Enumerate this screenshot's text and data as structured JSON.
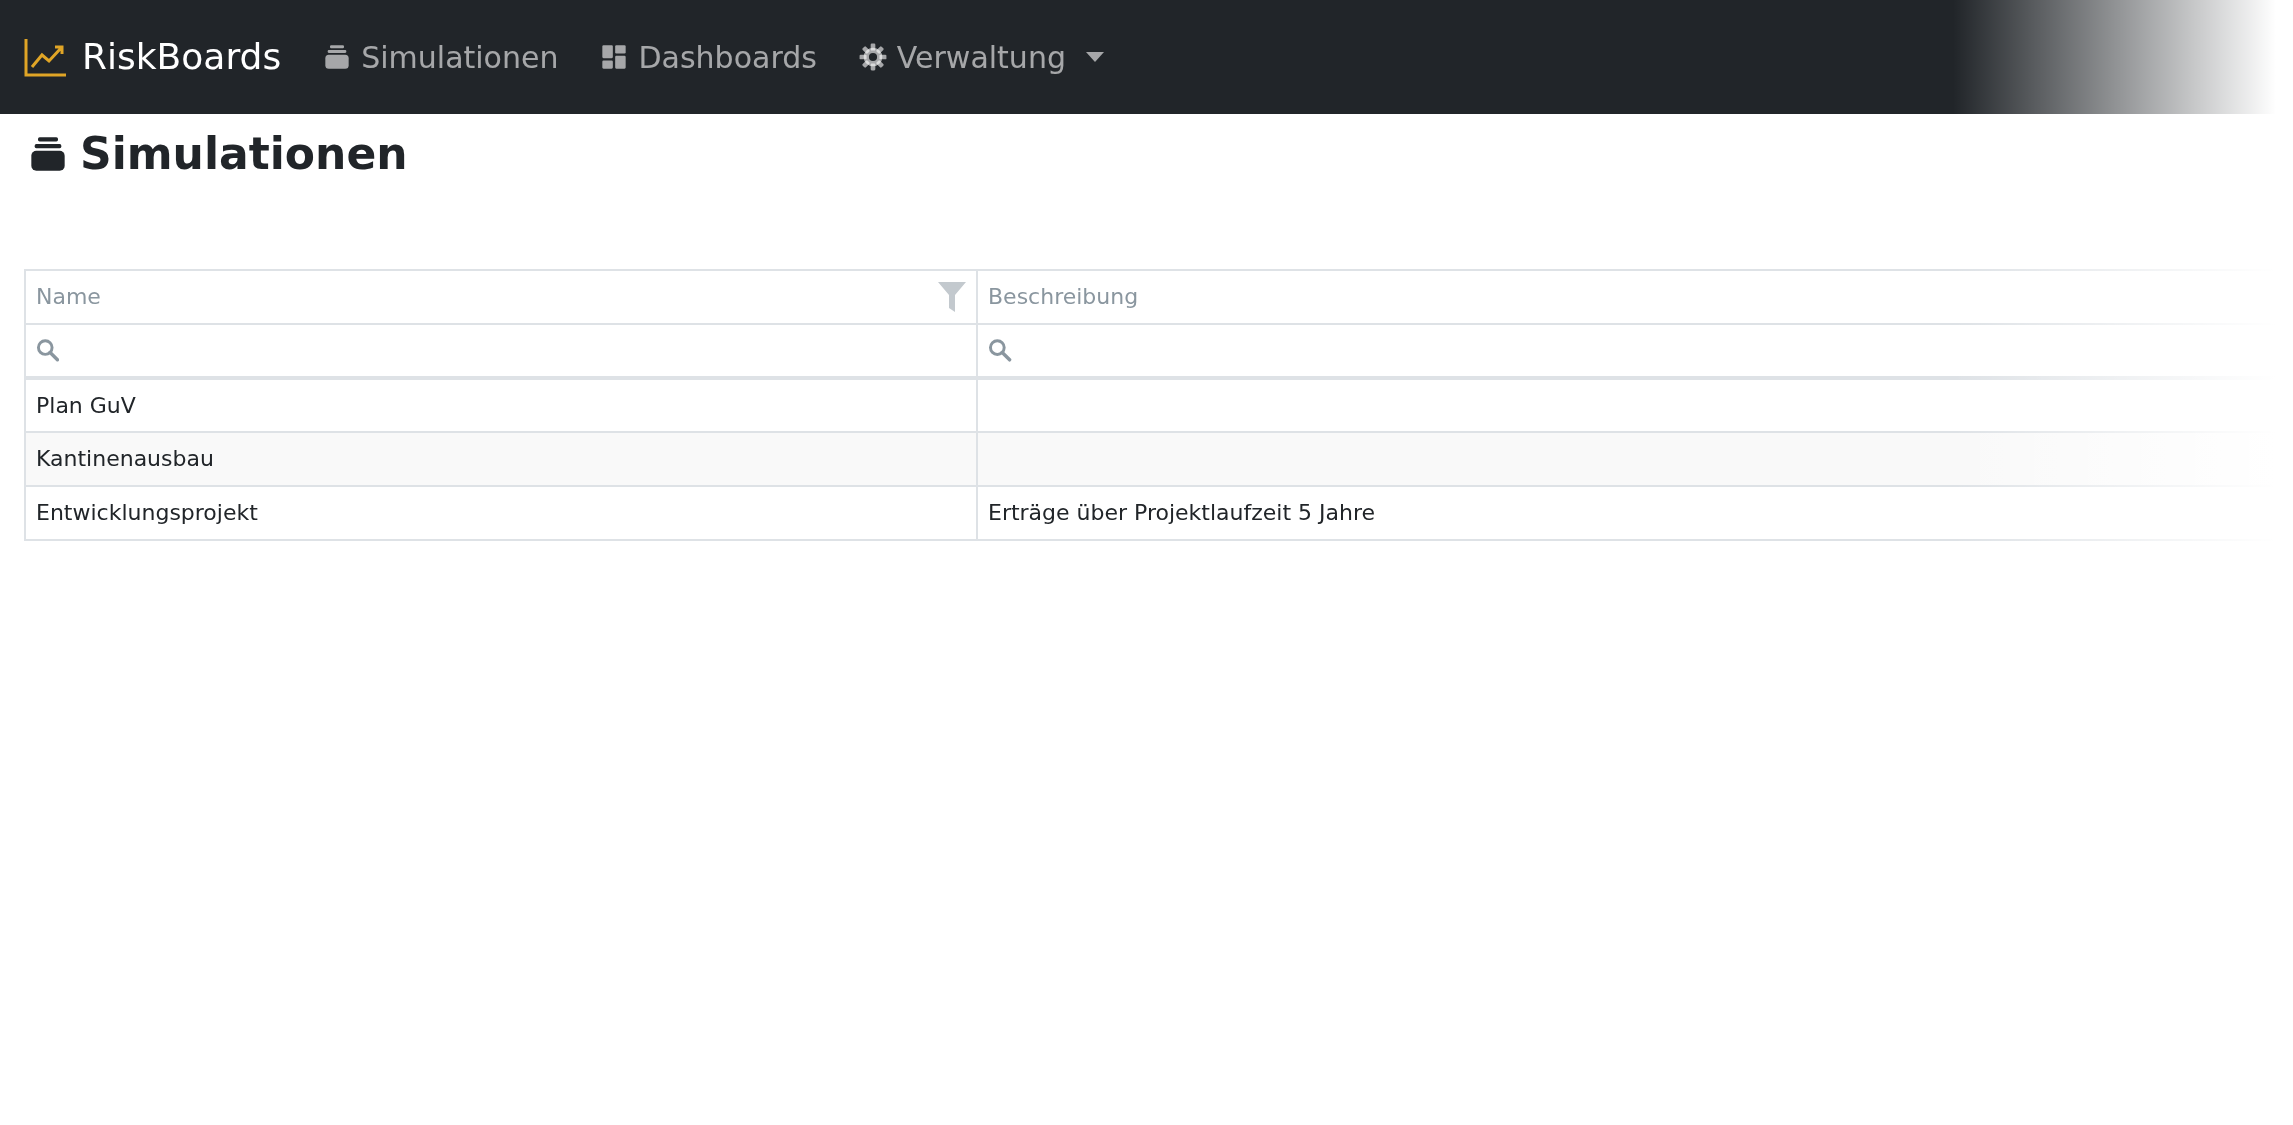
{
  "navbar": {
    "brand": "RiskBoards",
    "items": [
      {
        "label": "Simulationen",
        "kind": "link"
      },
      {
        "label": "Dashboards",
        "kind": "link"
      },
      {
        "label": "Verwaltung",
        "kind": "dropdown"
      }
    ]
  },
  "page": {
    "title": "Simulationen"
  },
  "table": {
    "columns": [
      {
        "label": "Name",
        "filter": true
      },
      {
        "label": "Beschreibung"
      }
    ],
    "rows": [
      [
        "Plan GuV",
        ""
      ],
      [
        "Kantinenausbau",
        ""
      ],
      [
        "Entwicklungsprojekt",
        "Erträge über Projektlaufzeit 5 Jahre"
      ]
    ]
  }
}
